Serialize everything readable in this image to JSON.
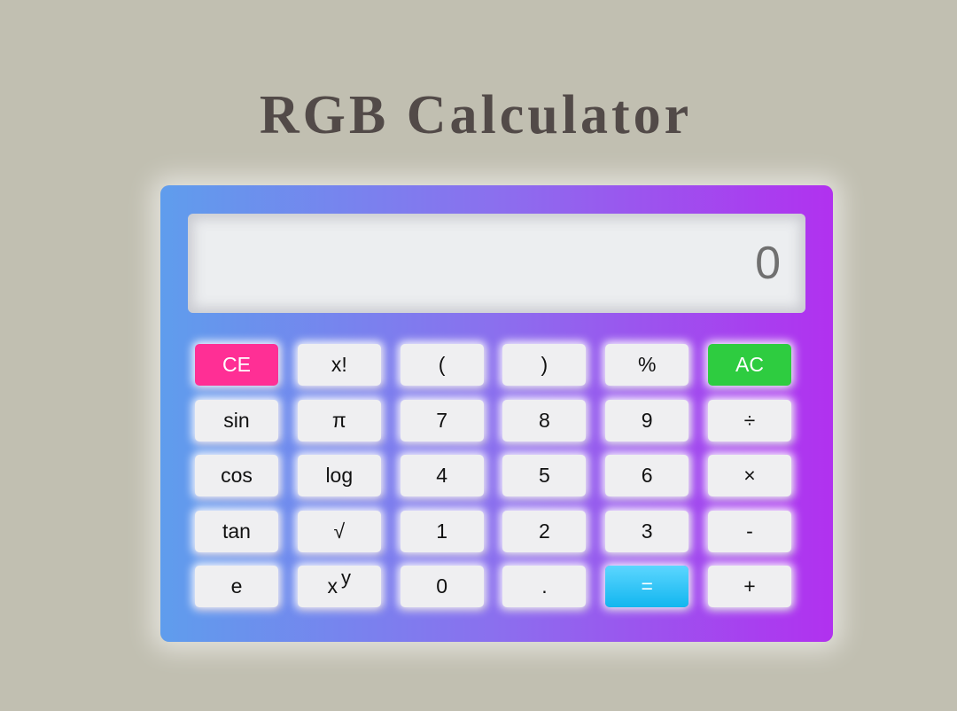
{
  "page": {
    "title": "RGB Calculator"
  },
  "display": {
    "value": "0"
  },
  "colors": {
    "background": "#c1bfb1",
    "title": "#524a48",
    "gradient_start": "#5f9ded",
    "gradient_end": "#b131ef",
    "key_default": "#efeff1",
    "key_ce": "#ff2f95",
    "key_ac": "#2ecc40",
    "key_equals": "#1ec2f5"
  },
  "keys": [
    {
      "label": "CE",
      "name": "clear-entry-button",
      "bg": "#ff2f95",
      "fg": "#ffffff"
    },
    {
      "label": "x!",
      "name": "factorial-button"
    },
    {
      "label": "(",
      "name": "open-paren-button"
    },
    {
      "label": ")",
      "name": "close-paren-button"
    },
    {
      "label": "%",
      "name": "percent-button"
    },
    {
      "label": "AC",
      "name": "all-clear-button",
      "bg": "#2ecc40",
      "fg": "#ffffff"
    },
    {
      "label": "sin",
      "name": "sin-button"
    },
    {
      "label": "π",
      "name": "pi-button"
    },
    {
      "label": "7",
      "name": "digit-7-button"
    },
    {
      "label": "8",
      "name": "digit-8-button"
    },
    {
      "label": "9",
      "name": "digit-9-button"
    },
    {
      "label": "÷",
      "name": "divide-button"
    },
    {
      "label": "cos",
      "name": "cos-button"
    },
    {
      "label": "log",
      "name": "log-button"
    },
    {
      "label": "4",
      "name": "digit-4-button"
    },
    {
      "label": "5",
      "name": "digit-5-button"
    },
    {
      "label": "6",
      "name": "digit-6-button"
    },
    {
      "label": "×",
      "name": "multiply-button"
    },
    {
      "label": "tan",
      "name": "tan-button"
    },
    {
      "label": "√",
      "name": "sqrt-button"
    },
    {
      "label": "1",
      "name": "digit-1-button"
    },
    {
      "label": "2",
      "name": "digit-2-button"
    },
    {
      "label": "3",
      "name": "digit-3-button"
    },
    {
      "label": "-",
      "name": "subtract-button"
    },
    {
      "label": "e",
      "name": "euler-button"
    },
    {
      "label": "x",
      "sup": "y",
      "name": "power-button"
    },
    {
      "label": "0",
      "name": "digit-0-button"
    },
    {
      "label": ".",
      "name": "decimal-button"
    },
    {
      "label": "=",
      "name": "equals-button",
      "bg": "#1ec2f5",
      "fg": "#ffffff"
    },
    {
      "label": "+",
      "name": "add-button"
    }
  ]
}
